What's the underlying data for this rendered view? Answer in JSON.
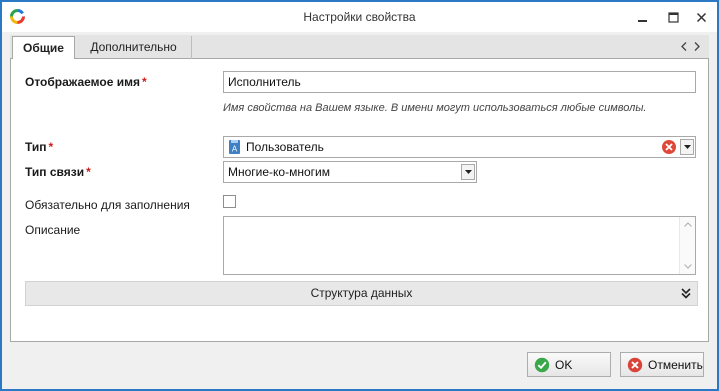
{
  "window": {
    "title": "Настройки свойства"
  },
  "tabs": [
    {
      "label": "Общие",
      "active": true
    },
    {
      "label": "Дополнительно",
      "active": false
    }
  ],
  "form": {
    "display_name": {
      "label": "Отображаемое имя",
      "required_mark": "*",
      "value": "Исполнитель",
      "hint": "Имя свойства на Вашем языке. В имени могут использоваться любые символы."
    },
    "type": {
      "label": "Тип",
      "required_mark": "*",
      "value": "Пользователь",
      "icon": "user-type-icon"
    },
    "link_type": {
      "label": "Тип связи",
      "required_mark": "*",
      "value": "Многие-ко-многим"
    },
    "required_field": {
      "label": "Обязательно для заполнения",
      "checked": false
    },
    "description": {
      "label": "Описание",
      "value": ""
    },
    "data_structure": {
      "label": "Структура данных"
    }
  },
  "buttons": {
    "ok": "OK",
    "cancel": "Отменить"
  },
  "colors": {
    "window_border": "#2b78c5",
    "required": "#d11a1a",
    "ok_green": "#3aa84a",
    "cancel_red": "#d9443a"
  }
}
